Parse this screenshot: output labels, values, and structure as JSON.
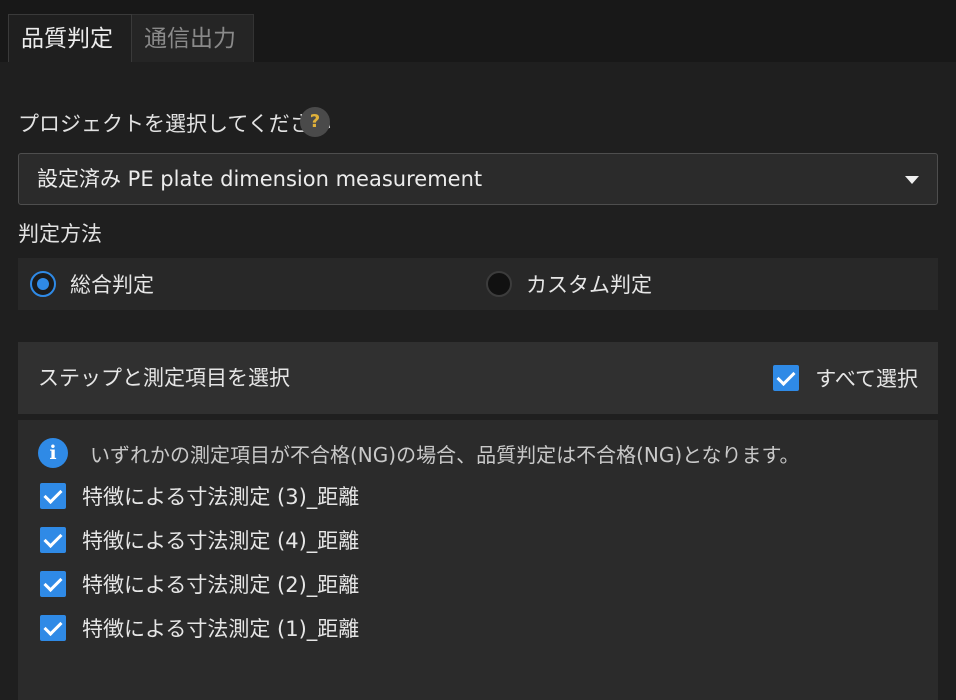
{
  "tabs": [
    {
      "label": "品質判定",
      "active": true
    },
    {
      "label": "通信出力",
      "active": false
    }
  ],
  "project": {
    "label": "プロジェクトを選択してください",
    "help_icon": "?",
    "selected": "設定済み PE plate dimension measurement"
  },
  "judgment": {
    "label": "判定方法",
    "options": [
      {
        "label": "総合判定",
        "selected": true
      },
      {
        "label": "カスタム判定",
        "selected": false
      }
    ]
  },
  "steps": {
    "title": "ステップと測定項目を選択",
    "select_all_label": "すべて選択",
    "select_all_checked": true,
    "info_icon": "i",
    "info": "いずれかの測定項目が不合格(NG)の場合、品質判定は不合格(NG)となります。",
    "items": [
      {
        "label": "特徴による寸法測定 (3)_距離",
        "checked": true
      },
      {
        "label": "特徴による寸法測定 (4)_距離",
        "checked": true
      },
      {
        "label": "特徴による寸法測定 (2)_距離",
        "checked": true
      },
      {
        "label": "特徴による寸法測定 (1)_距離",
        "checked": true
      }
    ]
  },
  "colors": {
    "accent": "#2f8ae6",
    "background": "#1f1f1f",
    "help_icon": "#e0b13a"
  }
}
